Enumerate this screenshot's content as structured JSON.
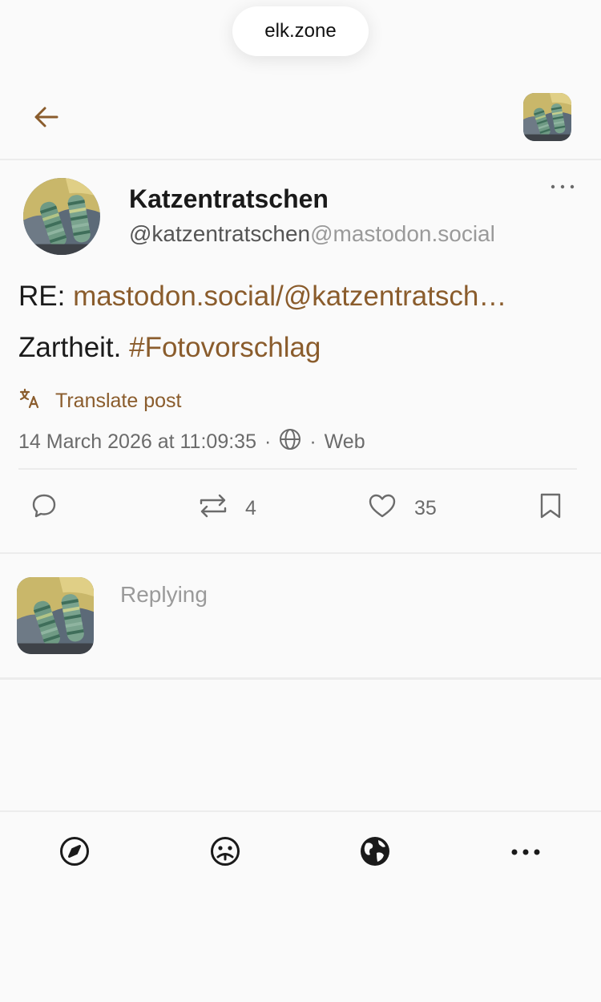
{
  "browser": {
    "url": "elk.zone"
  },
  "header": {
    "back_icon": "arrow-left-icon",
    "account_avatar": "account-avatar"
  },
  "post": {
    "display_name": "Katzentratschen",
    "handle_user": "@katzentratschen",
    "handle_server": "@mastodon.social",
    "content_prefix": "RE: ",
    "content_link": "mastodon.social/@katzentratsch…",
    "content_text": "Zartheit. ",
    "content_hashtag": "#Fotovorschlag",
    "translate_label": "Translate post",
    "timestamp": "14 March 2026 at 11:09:35",
    "meta_sep": "·",
    "client": "Web",
    "actions": {
      "reply_count": "",
      "boost_count": "4",
      "favourite_count": "35"
    }
  },
  "composer": {
    "placeholder": "Replying"
  },
  "bottom_nav": {
    "items": [
      "compass-icon",
      "face-icon",
      "globe-icon",
      "more-icon"
    ]
  },
  "colors": {
    "accent": "#8a5c2c",
    "text": "#1a1a1a",
    "muted": "#6b6b6b",
    "background": "#fafafa"
  }
}
